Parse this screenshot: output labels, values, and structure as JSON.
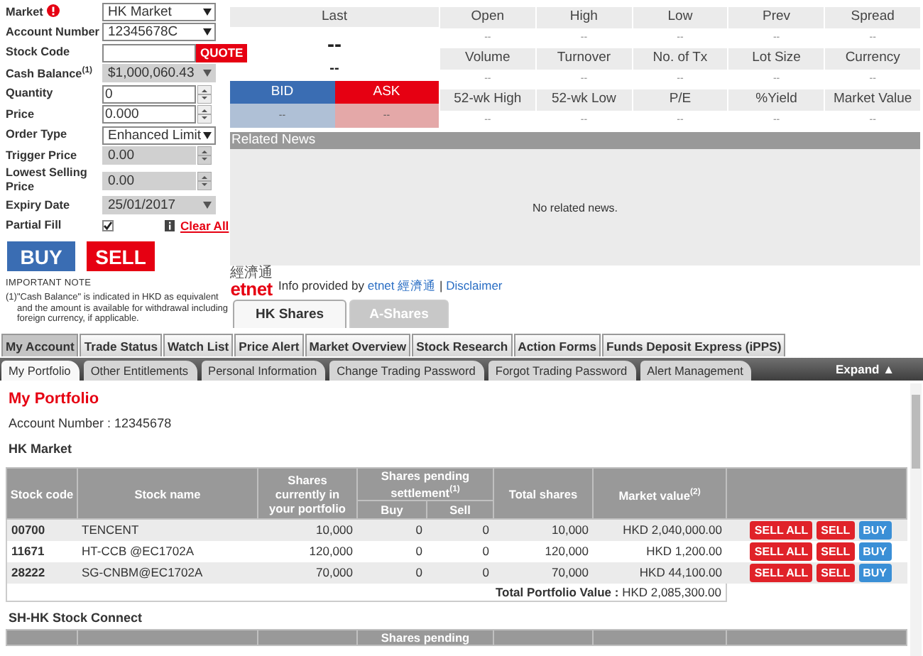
{
  "order_form": {
    "fields": [
      {
        "kind": "select",
        "label": "Market",
        "info": true,
        "value": "HK Market"
      },
      {
        "kind": "select",
        "label": "Account Number",
        "value": "12345678C"
      },
      {
        "kind": "quote",
        "label": "Stock Code",
        "button": "QUOTE"
      },
      {
        "kind": "select_disabled",
        "label": "Cash Balance$^{(1)}$",
        "value": "$1,000,060.43"
      },
      {
        "kind": "spinner",
        "label": "Quantity",
        "value": "0"
      },
      {
        "kind": "spinner",
        "label": "Price",
        "value": "0.000"
      },
      {
        "kind": "select",
        "label": "Order Type",
        "value": "Enhanced Limit"
      },
      {
        "kind": "spinner_disabled",
        "label": "Trigger Price",
        "value": "0.00"
      },
      {
        "kind": "spinner_disabled",
        "label": "Lowest Selling Price",
        "value": "0.00"
      },
      {
        "kind": "select_disabled",
        "label": "Expiry Date",
        "value": "25/01/2017"
      },
      {
        "kind": "checkbox",
        "label": "Partial Fill",
        "checked": true
      }
    ],
    "clear_all": "Clear All",
    "buy": "BUY",
    "sell": "SELL",
    "note_title": "IMPORTANT NOTE",
    "note": "(1)\"Cash Balance\" is indicated in HKD as equivalent and the amount is available for withdrawal including foreign currency, if applicable."
  },
  "quote": {
    "last_label": "Last",
    "last": "--",
    "change": "--",
    "bid_label": "BID",
    "ask_label": "ASK",
    "bid": "--",
    "ask": "--",
    "stats": [
      {
        "label": "Open",
        "value": "--"
      },
      {
        "label": "High",
        "value": "--"
      },
      {
        "label": "Low",
        "value": "--"
      },
      {
        "label": "Prev",
        "value": "--"
      },
      {
        "label": "Spread",
        "value": "--"
      },
      {
        "label": "Volume",
        "value": "--"
      },
      {
        "label": "Turnover",
        "value": "--"
      },
      {
        "label": "No. of Tx",
        "value": "--"
      },
      {
        "label": "Lot Size",
        "value": "--"
      },
      {
        "label": "Currency",
        "value": "--"
      },
      {
        "label": "52-wk High",
        "value": "--"
      },
      {
        "label": "52-wk Low",
        "value": "--"
      },
      {
        "label": "P/E",
        "value": "--"
      },
      {
        "label": "%Yield",
        "value": "--"
      },
      {
        "label": "Market Value",
        "value": "--"
      }
    ]
  },
  "news": {
    "title": "Related News",
    "empty": "No related news."
  },
  "provider": {
    "logo_top": "經濟通",
    "logo": "etnet",
    "text": "Info provided by",
    "link": "etnet 經濟通",
    "separator": "|",
    "disclaimer": "Disclaimer"
  },
  "market_tabs": [
    {
      "label": "HK Shares",
      "selected": true,
      "disabled": false
    },
    {
      "label": "A-Shares",
      "selected": false,
      "disabled": true
    }
  ],
  "main_tabs": [
    {
      "label": "My Account",
      "selected": true
    },
    {
      "label": "Trade Status",
      "selected": false
    },
    {
      "label": "Watch List",
      "selected": false
    },
    {
      "label": "Price Alert",
      "selected": false
    },
    {
      "label": "Market Overview",
      "selected": false
    },
    {
      "label": "Stock Research",
      "selected": false
    },
    {
      "label": "Action Forms",
      "selected": false
    },
    {
      "label": "Funds Deposit Express (iPPS)",
      "selected": false
    }
  ],
  "sub_tabs": [
    {
      "label": "My Portfolio",
      "selected": true
    },
    {
      "label": "Other Entitlements",
      "selected": false
    },
    {
      "label": "Personal Information",
      "selected": false
    },
    {
      "label": "Change Trading Password",
      "selected": false
    },
    {
      "label": "Forgot Trading Password",
      "selected": false
    },
    {
      "label": "Alert Management",
      "selected": false
    }
  ],
  "expand": {
    "label": "Expand",
    "icon": "▲"
  },
  "portfolio": {
    "title": "My Portfolio",
    "account": "Account Number : 12345678",
    "sections": [
      {
        "title": "HK Market",
        "column_group": "Shares pending settlement$^{(1)}$",
        "columns": [
          {
            "kind": "plain",
            "label": "Stock code"
          },
          {
            "kind": "plain",
            "label": "Stock name"
          },
          {
            "kind": "plain",
            "label": "Shares currently in your portfolio"
          },
          {
            "kind": "grouped",
            "label": "Buy"
          },
          {
            "kind": "grouped",
            "label": "Sell"
          },
          {
            "kind": "plain",
            "label": "Total shares"
          },
          {
            "kind": "plain",
            "label": "Market value$^{(2)}$"
          },
          {
            "kind": "plain"
          }
        ],
        "rows": [
          {
            "cells": [
              "00700",
              "TENCENT",
              "10,000",
              "0",
              "0",
              "10,000",
              "HKD 2,040,000.00"
            ],
            "actions": [
              {
                "kind": "sell",
                "label": "SELL ALL"
              },
              {
                "kind": "sell",
                "label": "SELL"
              },
              {
                "kind": "buy",
                "label": "BUY"
              }
            ]
          },
          {
            "cells": [
              "11671",
              "HT-CCB @EC1702A",
              "120,000",
              "0",
              "0",
              "120,000",
              "HKD 1,200.00"
            ],
            "actions": [
              {
                "kind": "sell",
                "label": "SELL ALL"
              },
              {
                "kind": "sell",
                "label": "SELL"
              },
              {
                "kind": "buy",
                "label": "BUY"
              }
            ]
          },
          {
            "cells": [
              "28222",
              "SG-CNBM@EC1702A",
              "70,000",
              "0",
              "0",
              "70,000",
              "HKD 44,100.00"
            ],
            "actions": [
              {
                "kind": "sell",
                "label": "SELL ALL"
              },
              {
                "kind": "sell",
                "label": "SELL"
              },
              {
                "kind": "buy",
                "label": "BUY"
              }
            ]
          }
        ],
        "total_label": "Total Portfolio Value :",
        "total_value": "HKD 2,085,300.00"
      },
      {
        "title": "SH-HK Stock Connect",
        "column_group": "Shares pending",
        "columns": [
          {
            "kind": "plain"
          },
          {
            "kind": "plain"
          },
          {
            "kind": "plain"
          },
          {
            "kind": "grouped"
          },
          {
            "kind": "grouped"
          },
          {
            "kind": "plain"
          },
          {
            "kind": "plain"
          },
          {
            "kind": "plain"
          }
        ]
      }
    ]
  }
}
